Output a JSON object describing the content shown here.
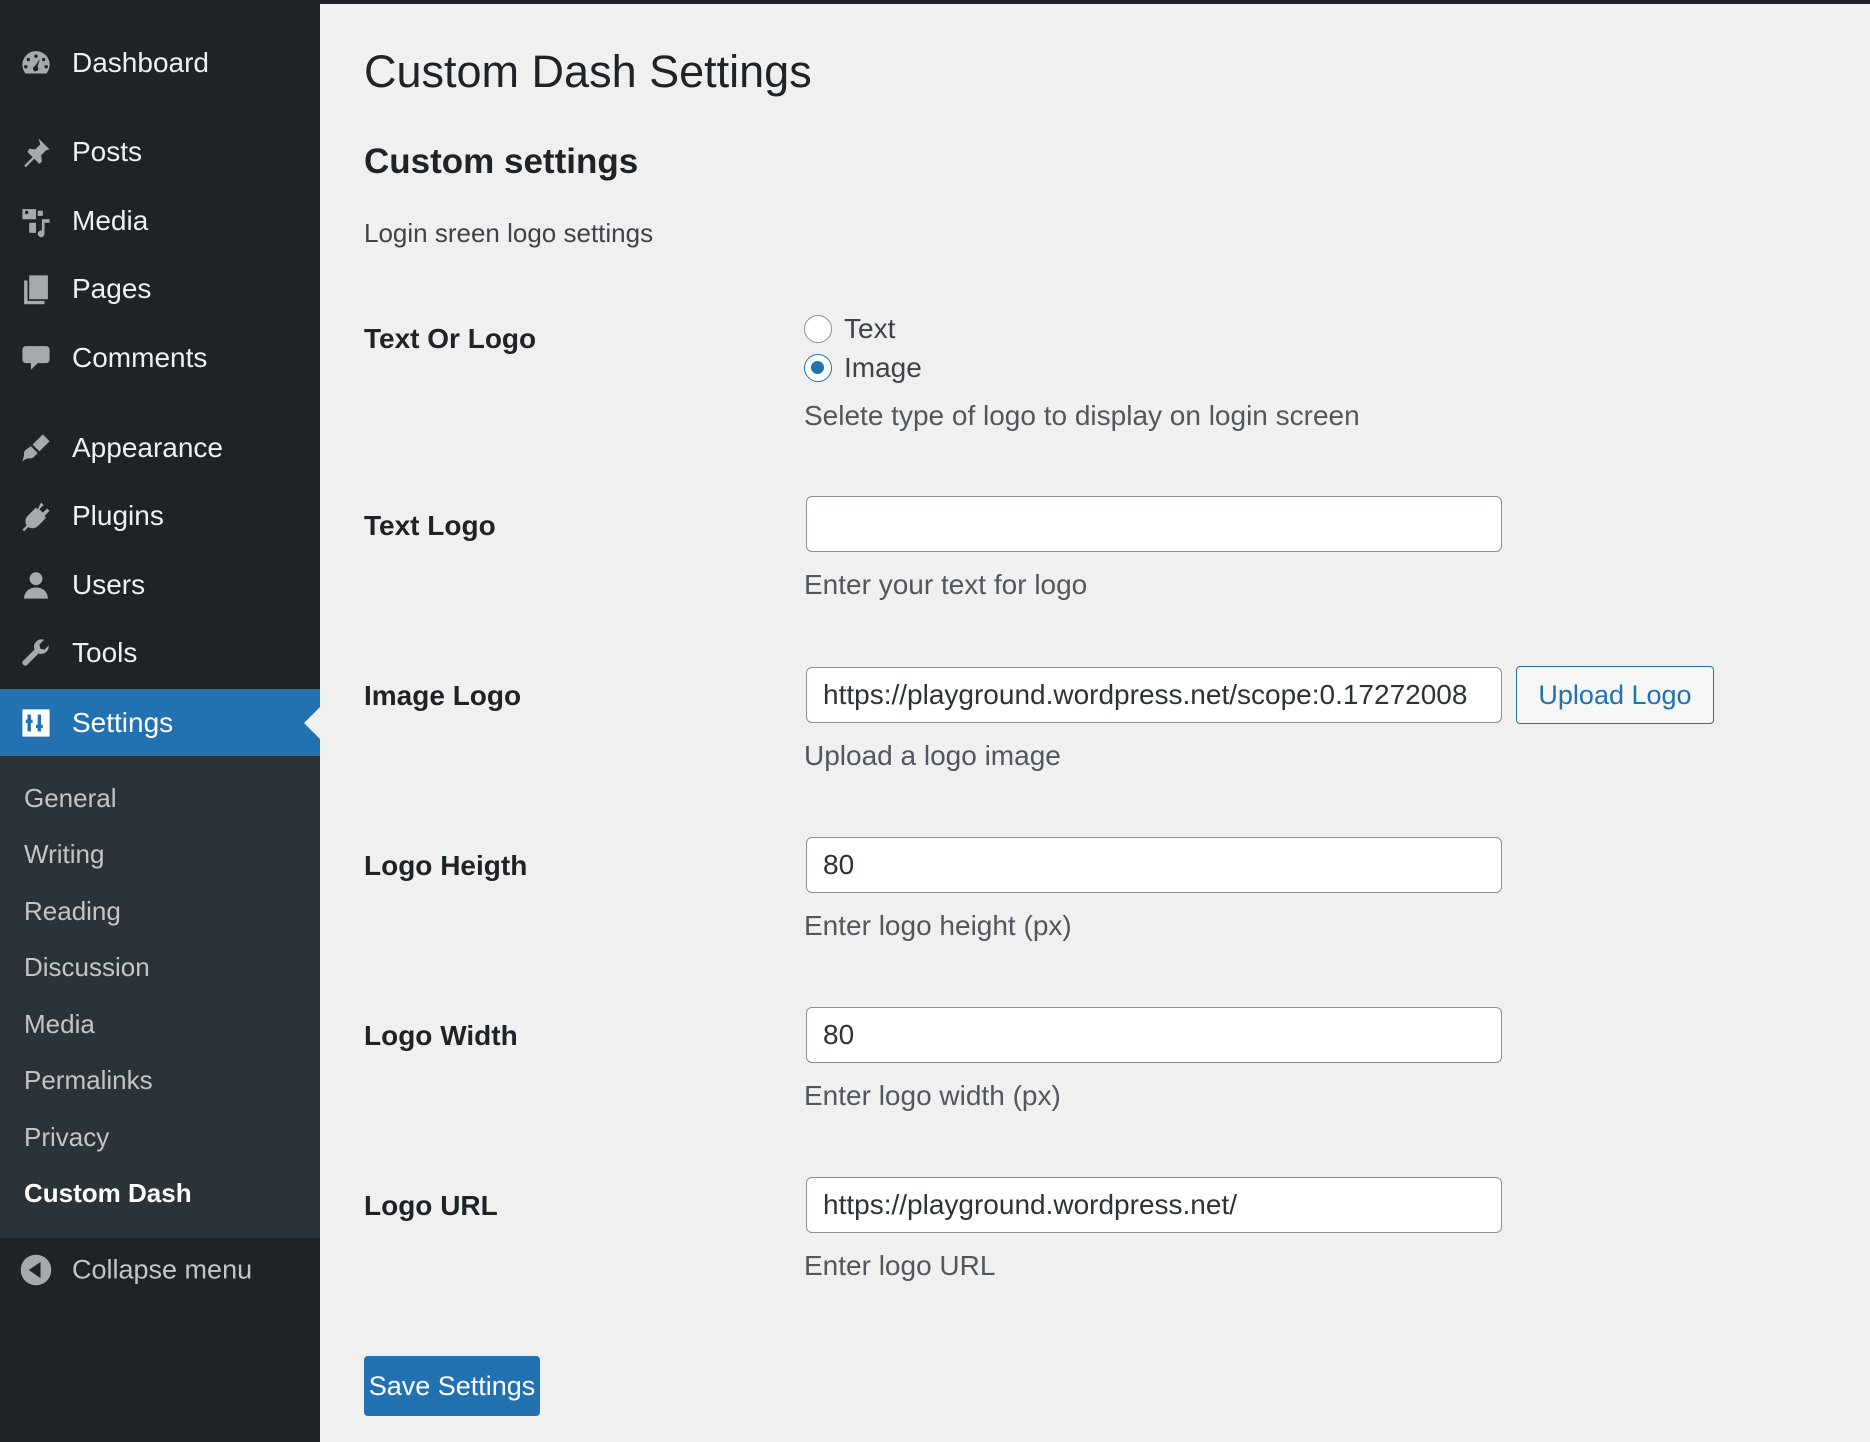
{
  "sidebar": {
    "items": [
      {
        "label": "Dashboard",
        "icon": "dashboard-icon"
      },
      {
        "label": "Posts",
        "icon": "pushpin-icon"
      },
      {
        "label": "Media",
        "icon": "media-icon"
      },
      {
        "label": "Pages",
        "icon": "pages-icon"
      },
      {
        "label": "Comments",
        "icon": "comment-icon"
      },
      {
        "label": "Appearance",
        "icon": "paintbrush-icon"
      },
      {
        "label": "Plugins",
        "icon": "plugin-icon"
      },
      {
        "label": "Users",
        "icon": "user-icon"
      },
      {
        "label": "Tools",
        "icon": "wrench-icon"
      },
      {
        "label": "Settings",
        "icon": "settings-icon",
        "active": true
      }
    ],
    "submenu": [
      "General",
      "Writing",
      "Reading",
      "Discussion",
      "Media",
      "Permalinks",
      "Privacy",
      "Custom Dash"
    ],
    "current_submenu": "Custom Dash",
    "collapse_label": "Collapse menu"
  },
  "page": {
    "title": "Custom Dash Settings",
    "section_title": "Custom settings",
    "section_description": "Login sreen logo settings"
  },
  "fields": {
    "text_or_logo": {
      "label": "Text Or Logo",
      "options": [
        "Text",
        "Image"
      ],
      "selected": "Image",
      "description": "Selete type of logo to display on login screen"
    },
    "text_logo": {
      "label": "Text Logo",
      "value": "",
      "description": "Enter your text for logo"
    },
    "image_logo": {
      "label": "Image Logo",
      "value": "https://playground.wordpress.net/scope:0.17272008",
      "button": "Upload Logo",
      "description": "Upload a logo image"
    },
    "logo_height": {
      "label": "Logo Heigth",
      "value": "80",
      "description": "Enter logo height (px)"
    },
    "logo_width": {
      "label": "Logo Width",
      "value": "80",
      "description": "Enter logo width (px)"
    },
    "logo_url": {
      "label": "Logo URL",
      "value": "https://playground.wordpress.net/",
      "description": "Enter logo URL"
    }
  },
  "save_button": "Save Settings",
  "colors": {
    "sidebar_bg": "#1d2327",
    "submenu_bg": "#2c3338",
    "accent": "#2271b1",
    "page_bg": "#f0f0f1"
  }
}
